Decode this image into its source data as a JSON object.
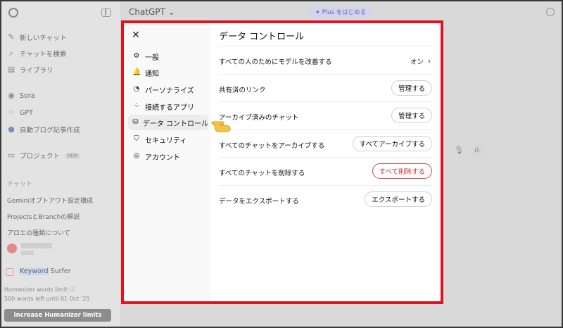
{
  "sidebar": {
    "items_top": [
      {
        "icon": "edit-icon",
        "glyph": "✎",
        "label": "新しいチャット"
      },
      {
        "icon": "search-icon",
        "glyph": "⌕",
        "label": "チャットを検索"
      },
      {
        "icon": "library-icon",
        "glyph": "▤",
        "label": "ライブラリ"
      }
    ],
    "items_apps": [
      {
        "icon": "sora-icon",
        "glyph": "◉",
        "label": "Sora"
      },
      {
        "icon": "gpt-icon",
        "glyph": "⁘",
        "label": "GPT"
      },
      {
        "icon": "blog-gpt-icon",
        "glyph": "●",
        "label": "自動ブログ記事作成"
      }
    ],
    "project": {
      "icon": "folder-icon",
      "glyph": "▭",
      "label": "プロジェクト",
      "badge": "NEW"
    },
    "chats_heading": "チャット",
    "chats": [
      "Geminiオプトアウト設定構成",
      "ProjectsとBranchの解説",
      "アロエの種類について"
    ],
    "keyword_surfer": {
      "highlight": "Keyword",
      "rest": " Surfer"
    },
    "humanizer_limit": "Humanizer words limit ⓘ",
    "humanizer_left": "500 words left until 01 Oct '25",
    "increase_button": "Increase Humanizer limits"
  },
  "header": {
    "app_title": "ChatGPT ⌄",
    "plus_pill": "✦ Plus をはじめる"
  },
  "modal": {
    "nav": [
      {
        "name": "general",
        "icon": "gear-icon",
        "glyph": "⚙",
        "label": "一般"
      },
      {
        "name": "notifications",
        "icon": "bell-icon",
        "glyph": "🔔",
        "label": "通知"
      },
      {
        "name": "personalization",
        "icon": "personalize-icon",
        "glyph": "◔",
        "label": "パーソナライズ"
      },
      {
        "name": "connected-apps",
        "icon": "apps-icon",
        "glyph": "⁘",
        "label": "接続するアプリ"
      },
      {
        "name": "data-controls",
        "icon": "database-icon",
        "glyph": "⛁",
        "label": "データ コントロール"
      },
      {
        "name": "security",
        "icon": "shield-icon",
        "glyph": "⛉",
        "label": "セキュリティ"
      },
      {
        "name": "account",
        "icon": "account-icon",
        "glyph": "◎",
        "label": "アカウント"
      }
    ],
    "active_nav": "data-controls",
    "title": "データ コントロール",
    "rows": {
      "improve_model": {
        "label": "すべての人のためにモデルを改善する",
        "value": "オン",
        "chevron": "›"
      },
      "shared_links": {
        "label": "共有済のリンク",
        "button": "管理する"
      },
      "archived_chats": {
        "label": "アーカイブ済みのチャット",
        "button": "管理する"
      },
      "archive_all": {
        "label": "すべてのチャットをアーカイブする",
        "button": "すべてアーカイブする"
      },
      "delete_all": {
        "label": "すべてのチャットを削除する",
        "button": "すべて削除する"
      },
      "export": {
        "label": "データをエクスポートする",
        "button": "エクスポートする"
      }
    }
  },
  "colors": {
    "highlight_box": "#e0141e",
    "danger": "#d03030"
  }
}
